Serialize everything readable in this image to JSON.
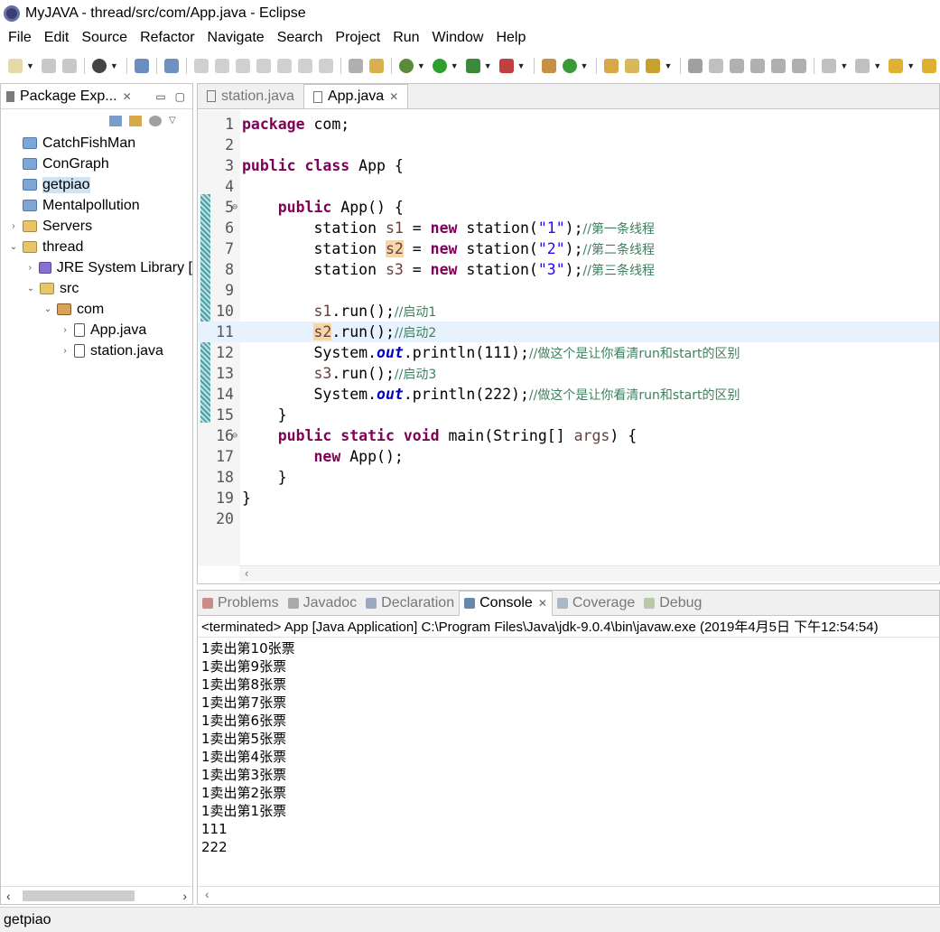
{
  "window": {
    "title": "MyJAVA - thread/src/com/App.java - Eclipse"
  },
  "menu": [
    "File",
    "Edit",
    "Source",
    "Refactor",
    "Navigate",
    "Search",
    "Project",
    "Run",
    "Window",
    "Help"
  ],
  "package_explorer": {
    "tab_label": "Package Exp...",
    "items": [
      {
        "label": "CatchFishMan",
        "depth": 0,
        "arrow": "",
        "icon": "folder"
      },
      {
        "label": "ConGraph",
        "depth": 0,
        "arrow": "",
        "icon": "folder"
      },
      {
        "label": "getpiao",
        "depth": 0,
        "arrow": "",
        "icon": "folder",
        "selected": true
      },
      {
        "label": "Mentalpollution",
        "depth": 0,
        "arrow": "",
        "icon": "folder"
      },
      {
        "label": "Servers",
        "depth": 0,
        "arrow": "›",
        "icon": "pfolder"
      },
      {
        "label": "thread",
        "depth": 0,
        "arrow": "⌄",
        "icon": "pfolder"
      },
      {
        "label": "JRE System Library [",
        "depth": 1,
        "arrow": "›",
        "icon": "jar"
      },
      {
        "label": "src",
        "depth": 1,
        "arrow": "⌄",
        "icon": "pfolder"
      },
      {
        "label": "com",
        "depth": 2,
        "arrow": "⌄",
        "icon": "pkgicon"
      },
      {
        "label": "App.java",
        "depth": 3,
        "arrow": "›",
        "icon": "jfile"
      },
      {
        "label": "station.java",
        "depth": 3,
        "arrow": "›",
        "icon": "jfile"
      }
    ]
  },
  "editor": {
    "tabs": [
      {
        "label": "station.java",
        "active": false
      },
      {
        "label": "App.java",
        "active": true
      }
    ],
    "lines": [
      {
        "n": "1",
        "html": "<span class='kw'>package</span> com;"
      },
      {
        "n": "2",
        "html": ""
      },
      {
        "n": "3",
        "html": "<span class='kw'>public class</span> App {"
      },
      {
        "n": "4",
        "html": ""
      },
      {
        "n": "5",
        "fold": "⊖",
        "html": "    <span class='kw'>public</span> App() {"
      },
      {
        "n": "6",
        "html": "        station <span class='var'>s1</span> = <span class='kw'>new</span> station(<span class='str'>\"1\"</span>);<span class='cm'>//第一条线程</span>"
      },
      {
        "n": "7",
        "html": "        station <span class='var occ'>s2</span> = <span class='kw'>new</span> station(<span class='str'>\"2\"</span>);<span class='cm'>//第二条线程</span>"
      },
      {
        "n": "8",
        "html": "        station <span class='var'>s3</span> = <span class='kw'>new</span> station(<span class='str'>\"3\"</span>);<span class='cm'>//第三条线程</span>"
      },
      {
        "n": "9",
        "html": ""
      },
      {
        "n": "10",
        "html": "        <span class='var'>s1</span>.run();<span class='cm'>//启动1</span>"
      },
      {
        "n": "11",
        "hl": true,
        "html": "        <span class='var occ'>s2</span>.run();<span class='cm'>//启动2</span>"
      },
      {
        "n": "12",
        "html": "        System.<span class='fld'>out</span>.println(111);<span class='cm'>//做这个是让你看清run和start的区别</span>"
      },
      {
        "n": "13",
        "html": "        <span class='var'>s3</span>.run();<span class='cm'>//启动3</span>"
      },
      {
        "n": "14",
        "html": "        System.<span class='fld'>out</span>.println(222);<span class='cm'>//做这个是让你看清run和start的区别</span>"
      },
      {
        "n": "15",
        "html": "    }"
      },
      {
        "n": "16",
        "fold": "⊖",
        "html": "    <span class='kw'>public static void</span> main(String[] <span class='var'>args</span>) {"
      },
      {
        "n": "17",
        "html": "        <span class='kw'>new</span> App();"
      },
      {
        "n": "18",
        "html": "    }"
      },
      {
        "n": "19",
        "html": "}"
      },
      {
        "n": "20",
        "html": ""
      }
    ]
  },
  "console": {
    "tabs": [
      {
        "label": "Problems",
        "active": false,
        "color": "#c98a8a"
      },
      {
        "label": "Javadoc",
        "active": false,
        "color": "#aaaaaa"
      },
      {
        "label": "Declaration",
        "active": false,
        "color": "#9aa8c0"
      },
      {
        "label": "Console",
        "active": true,
        "color": "#6688aa"
      },
      {
        "label": "Coverage",
        "active": false,
        "color": "#a8b8c8"
      },
      {
        "label": "Debug",
        "active": false,
        "color": "#b8c8a8"
      }
    ],
    "status": "<terminated> App [Java Application] C:\\Program Files\\Java\\jdk-9.0.4\\bin\\javaw.exe (2019年4月5日 下午12:54:54)",
    "output": [
      "1卖出第10张票",
      "1卖出第9张票",
      "1卖出第8张票",
      "1卖出第7张票",
      "1卖出第6张票",
      "1卖出第5张票",
      "1卖出第4张票",
      "1卖出第3张票",
      "1卖出第2张票",
      "1卖出第1张票",
      "111",
      "222"
    ]
  },
  "statusbar": {
    "text": "getpiao"
  }
}
